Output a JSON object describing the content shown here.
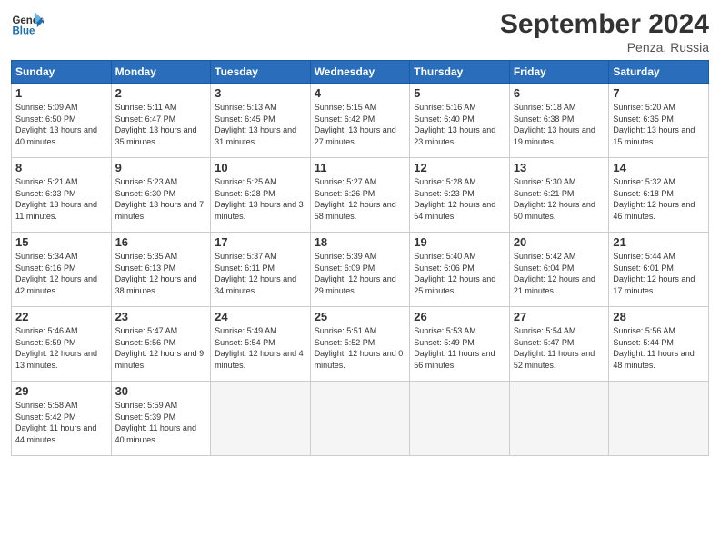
{
  "header": {
    "logo_line1": "General",
    "logo_line2": "Blue",
    "month": "September 2024",
    "location": "Penza, Russia"
  },
  "weekdays": [
    "Sunday",
    "Monday",
    "Tuesday",
    "Wednesday",
    "Thursday",
    "Friday",
    "Saturday"
  ],
  "weeks": [
    [
      {
        "day": 1,
        "sunrise": "5:09 AM",
        "sunset": "6:50 PM",
        "daylight": "13 hours and 40 minutes."
      },
      {
        "day": 2,
        "sunrise": "5:11 AM",
        "sunset": "6:47 PM",
        "daylight": "13 hours and 35 minutes."
      },
      {
        "day": 3,
        "sunrise": "5:13 AM",
        "sunset": "6:45 PM",
        "daylight": "13 hours and 31 minutes."
      },
      {
        "day": 4,
        "sunrise": "5:15 AM",
        "sunset": "6:42 PM",
        "daylight": "13 hours and 27 minutes."
      },
      {
        "day": 5,
        "sunrise": "5:16 AM",
        "sunset": "6:40 PM",
        "daylight": "13 hours and 23 minutes."
      },
      {
        "day": 6,
        "sunrise": "5:18 AM",
        "sunset": "6:38 PM",
        "daylight": "13 hours and 19 minutes."
      },
      {
        "day": 7,
        "sunrise": "5:20 AM",
        "sunset": "6:35 PM",
        "daylight": "13 hours and 15 minutes."
      }
    ],
    [
      {
        "day": 8,
        "sunrise": "5:21 AM",
        "sunset": "6:33 PM",
        "daylight": "13 hours and 11 minutes."
      },
      {
        "day": 9,
        "sunrise": "5:23 AM",
        "sunset": "6:30 PM",
        "daylight": "13 hours and 7 minutes."
      },
      {
        "day": 10,
        "sunrise": "5:25 AM",
        "sunset": "6:28 PM",
        "daylight": "13 hours and 3 minutes."
      },
      {
        "day": 11,
        "sunrise": "5:27 AM",
        "sunset": "6:26 PM",
        "daylight": "12 hours and 58 minutes."
      },
      {
        "day": 12,
        "sunrise": "5:28 AM",
        "sunset": "6:23 PM",
        "daylight": "12 hours and 54 minutes."
      },
      {
        "day": 13,
        "sunrise": "5:30 AM",
        "sunset": "6:21 PM",
        "daylight": "12 hours and 50 minutes."
      },
      {
        "day": 14,
        "sunrise": "5:32 AM",
        "sunset": "6:18 PM",
        "daylight": "12 hours and 46 minutes."
      }
    ],
    [
      {
        "day": 15,
        "sunrise": "5:34 AM",
        "sunset": "6:16 PM",
        "daylight": "12 hours and 42 minutes."
      },
      {
        "day": 16,
        "sunrise": "5:35 AM",
        "sunset": "6:13 PM",
        "daylight": "12 hours and 38 minutes."
      },
      {
        "day": 17,
        "sunrise": "5:37 AM",
        "sunset": "6:11 PM",
        "daylight": "12 hours and 34 minutes."
      },
      {
        "day": 18,
        "sunrise": "5:39 AM",
        "sunset": "6:09 PM",
        "daylight": "12 hours and 29 minutes."
      },
      {
        "day": 19,
        "sunrise": "5:40 AM",
        "sunset": "6:06 PM",
        "daylight": "12 hours and 25 minutes."
      },
      {
        "day": 20,
        "sunrise": "5:42 AM",
        "sunset": "6:04 PM",
        "daylight": "12 hours and 21 minutes."
      },
      {
        "day": 21,
        "sunrise": "5:44 AM",
        "sunset": "6:01 PM",
        "daylight": "12 hours and 17 minutes."
      }
    ],
    [
      {
        "day": 22,
        "sunrise": "5:46 AM",
        "sunset": "5:59 PM",
        "daylight": "12 hours and 13 minutes."
      },
      {
        "day": 23,
        "sunrise": "5:47 AM",
        "sunset": "5:56 PM",
        "daylight": "12 hours and 9 minutes."
      },
      {
        "day": 24,
        "sunrise": "5:49 AM",
        "sunset": "5:54 PM",
        "daylight": "12 hours and 4 minutes."
      },
      {
        "day": 25,
        "sunrise": "5:51 AM",
        "sunset": "5:52 PM",
        "daylight": "12 hours and 0 minutes."
      },
      {
        "day": 26,
        "sunrise": "5:53 AM",
        "sunset": "5:49 PM",
        "daylight": "11 hours and 56 minutes."
      },
      {
        "day": 27,
        "sunrise": "5:54 AM",
        "sunset": "5:47 PM",
        "daylight": "11 hours and 52 minutes."
      },
      {
        "day": 28,
        "sunrise": "5:56 AM",
        "sunset": "5:44 PM",
        "daylight": "11 hours and 48 minutes."
      }
    ],
    [
      {
        "day": 29,
        "sunrise": "5:58 AM",
        "sunset": "5:42 PM",
        "daylight": "11 hours and 44 minutes."
      },
      {
        "day": 30,
        "sunrise": "5:59 AM",
        "sunset": "5:39 PM",
        "daylight": "11 hours and 40 minutes."
      },
      null,
      null,
      null,
      null,
      null
    ]
  ]
}
